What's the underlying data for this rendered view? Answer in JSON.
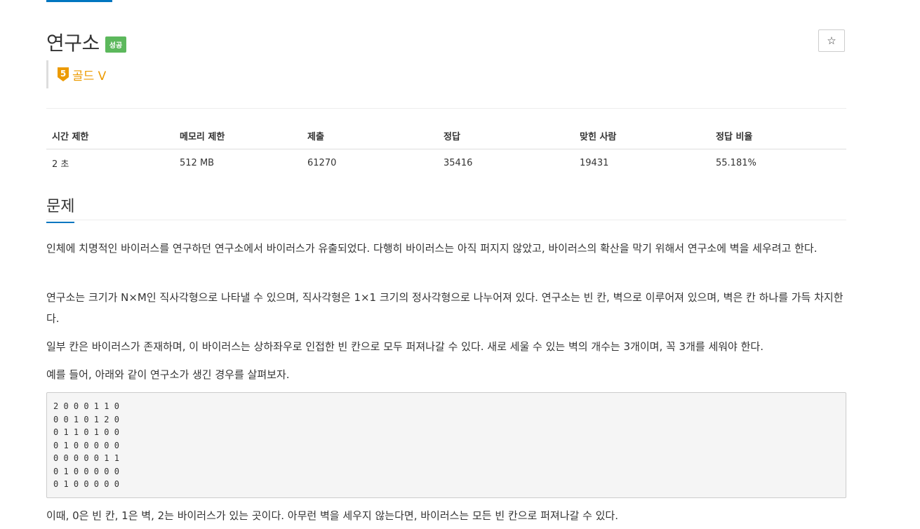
{
  "problem": {
    "title": "연구소",
    "status_badge": "성공",
    "tier_number": "5",
    "tier_label": "골드 V",
    "star_icon": "☆"
  },
  "info_table": {
    "headers": [
      "시간 제한",
      "메모리 제한",
      "제출",
      "정답",
      "맞힌 사람",
      "정답 비율"
    ],
    "values": [
      "2 초",
      "512 MB",
      "61270",
      "35416",
      "19431",
      "55.181%"
    ]
  },
  "section": {
    "title": "문제"
  },
  "paragraphs": [
    "인체에 치명적인 바이러스를 연구하던 연구소에서 바이러스가 유출되었다. 다행히 바이러스는 아직 퍼지지 않았고, 바이러스의 확산을 막기 위해서 연구소에 벽을 세우려고 한다.",
    "연구소는 크기가 N×M인 직사각형으로 나타낼 수 있으며, 직사각형은 1×1 크기의 정사각형으로 나누어져 있다. 연구소는 빈 칸, 벽으로 이루어져 있으며, 벽은 칸 하나를 가득 차지한다.",
    "일부 칸은 바이러스가 존재하며, 이 바이러스는 상하좌우로 인접한 빈 칸으로 모두 퍼져나갈 수 있다. 새로 세울 수 있는 벽의 개수는 3개이며, 꼭 3개를 세워야 한다.",
    "예를 들어, 아래와 같이 연구소가 생긴 경우를 살펴보자.",
    "이때, 0은 빈 칸, 1은 벽, 2는 바이러스가 있는 곳이다. 아무런 벽을 세우지 않는다면, 바이러스는 모든 빈 칸으로 퍼져나갈 수 있다."
  ],
  "example_grid": "2 0 0 0 1 1 0\n0 0 1 0 1 2 0\n0 1 1 0 1 0 0\n0 1 0 0 0 0 0\n0 0 0 0 0 1 1\n0 1 0 0 0 0 0\n0 1 0 0 0 0 0",
  "colors": {
    "accent_blue": "#0076c0",
    "success_green": "#5cb85c",
    "gold_tier": "#ec9a00"
  }
}
